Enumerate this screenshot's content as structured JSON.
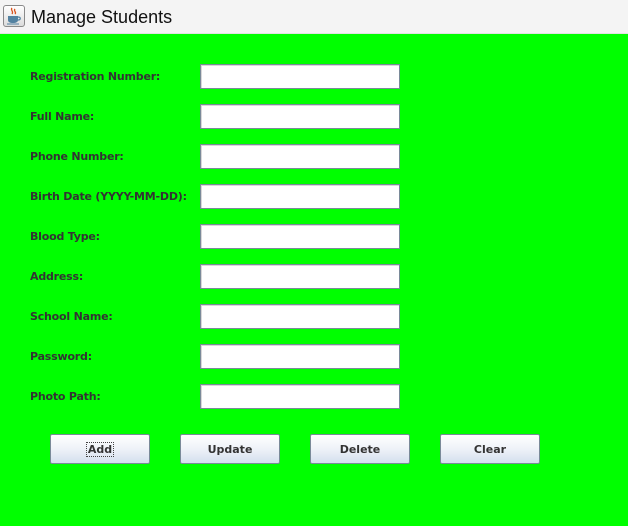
{
  "window": {
    "title": "Manage Students",
    "icon": "java-coffee-cup-icon"
  },
  "form": {
    "fields": [
      {
        "name": "registration-number",
        "label": "Registration Number:",
        "value": ""
      },
      {
        "name": "full-name",
        "label": "Full Name:",
        "value": ""
      },
      {
        "name": "phone-number",
        "label": "Phone Number:",
        "value": ""
      },
      {
        "name": "birth-date",
        "label": "Birth Date (YYYY-MM-DD):",
        "value": ""
      },
      {
        "name": "blood-type",
        "label": "Blood Type:",
        "value": ""
      },
      {
        "name": "address",
        "label": "Address:",
        "value": ""
      },
      {
        "name": "school-name",
        "label": "School Name:",
        "value": ""
      },
      {
        "name": "password",
        "label": "Password:",
        "value": ""
      },
      {
        "name": "photo-path",
        "label": "Photo Path:",
        "value": ""
      }
    ]
  },
  "buttons": {
    "add": "Add",
    "update": "Update",
    "delete": "Delete",
    "clear": "Clear"
  },
  "colors": {
    "panel_background": "#00ff00",
    "titlebar_background": "#f4f4f4"
  }
}
